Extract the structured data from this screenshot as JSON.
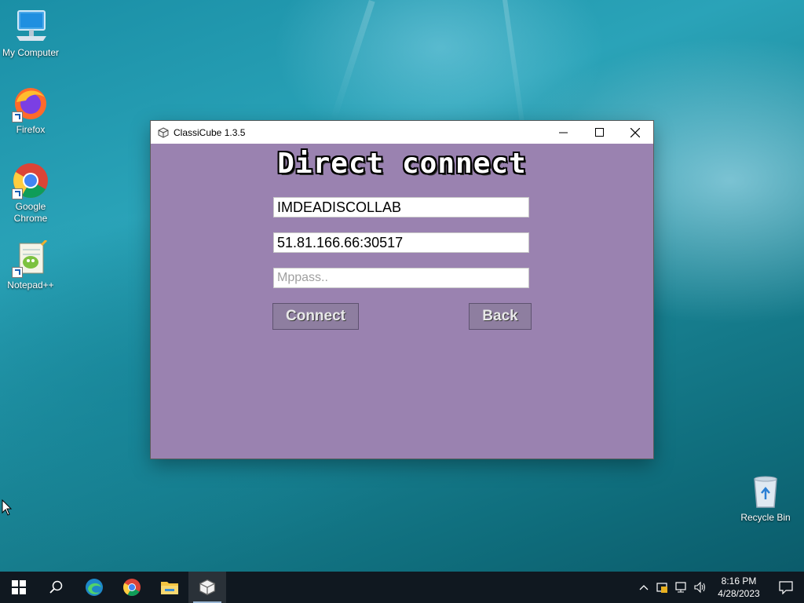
{
  "desktop": {
    "icons": [
      {
        "label": "My Computer"
      },
      {
        "label": "Firefox"
      },
      {
        "label": "Google Chrome"
      },
      {
        "label": "Notepad++"
      },
      {
        "label": "Recycle Bin"
      }
    ]
  },
  "window": {
    "title": "ClassiCube 1.3.5",
    "heading": "Direct connect",
    "username_value": "IMDEADISCOLLAB",
    "address_value": "51.81.166.66:30517",
    "mppass_placeholder": "Mppass..",
    "connect_label": "Connect",
    "back_label": "Back"
  },
  "taskbar": {
    "time": "8:16 PM",
    "date": "4/28/2023"
  },
  "colors": {
    "window_bg": "#9a82b0",
    "taskbar_bg": "#101820"
  }
}
